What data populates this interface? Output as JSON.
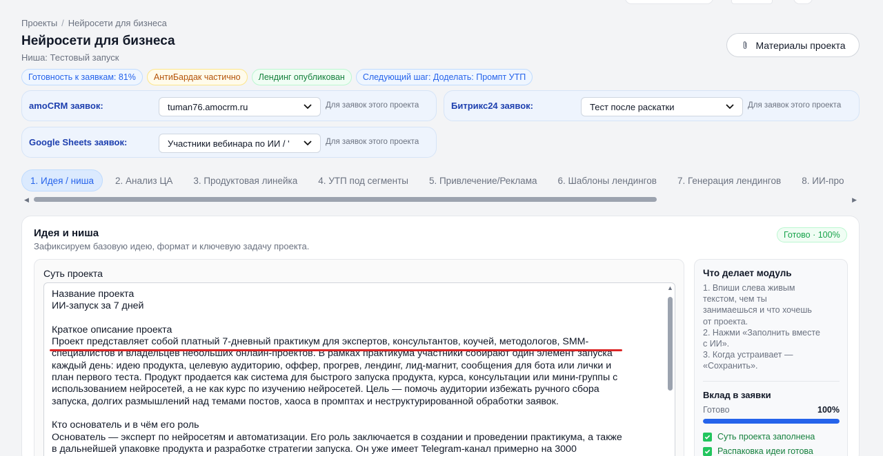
{
  "breadcrumb": {
    "root": "Проекты",
    "separator": "/",
    "current": "Нейросети для бизнеса"
  },
  "header": {
    "title": "Нейросети для бизнеса",
    "niche": "Ниша: Тестовый запуск",
    "materials_button": "Материалы проекта"
  },
  "badges": [
    {
      "label": "Готовность к заявкам: 81%",
      "tone": "blue"
    },
    {
      "label": "АнтиБардак частично",
      "tone": "amber"
    },
    {
      "label": "Лендинг опубликован",
      "tone": "green"
    },
    {
      "label": "Следующий шаг: Доделать: Промпт УТП",
      "tone": "blue"
    }
  ],
  "integrations": {
    "amocrm": {
      "label": "amoCRM заявок:",
      "value": "tuman76.amocrm.ru",
      "hint": "Для заявок этого проекта"
    },
    "bitrix": {
      "label": "Битрикс24 заявок:",
      "value": "Тест после раскатки",
      "hint": "Для заявок этого проекта"
    },
    "gsheets": {
      "label": "Google Sheets заявок:",
      "value": "Участники вебинара по ИИ / '",
      "hint": "Для заявок этого проекта"
    }
  },
  "tabs": [
    "1. Идея / ниша",
    "2. Анализ ЦА",
    "3. Продуктовая линейка",
    "4. УТП под сегменты",
    "5. Привлечение/Реклама",
    "6. Шаблоны лендингов",
    "7. Генерация лендингов",
    "8. ИИ-про"
  ],
  "active_tab": 0,
  "module": {
    "title": "Идея и ниша",
    "subtitle": "Зафиксируем базовую идею, формат и ключевую задачу проекта.",
    "status": "Готово · 100%",
    "essence_label": "Суть проекта",
    "essence_lines": [
      "Название проекта",
      "ИИ-запуск за 7 дней",
      "",
      "Краткое описание проекта",
      "Проект представляет собой платный 7-дневный практикум для экспертов, консультантов, коучей, методологов, SMM-",
      "специалистов и владельцев небольших онлайн-проектов. В рамках практикума участники собирают один элемент запуска",
      "каждый день: идею продукта, целевую аудиторию, оффер, прогрев, лендинг, лид-магнит, сообщения для бота или лички и",
      "план первого теста. Продукт продается как система для быстрого запуска продукта, курса, консультации или мини-группы с",
      "использованием нейросетей, а не как курс по изучению нейросетей. Цель — помочь аудитории избежать ручного сбора",
      "запуска, долгих размышлений над темами постов, хаоса в промптах и неструктурированной обработки заявок.",
      "",
      "Кто основатель и в чём его роль",
      "Основатель — эксперт по нейросетям и автоматизации. Его роль заключается в создании и проведении практикума, а также",
      "в дальнейшей упаковке продукта и разработке стратегии запуска. Он уже имеет Telegram-канал примерно на 3000"
    ]
  },
  "side": {
    "title": "Что делает модуль",
    "steps": [
      "1. Впиши слева живым",
      "текстом, чем ты",
      "занимаешься и что хочешь",
      "от проекта.",
      "2. Нажми «Заполнить вместе",
      "с ИИ».",
      "3. Когда устраивает —",
      "«Сохранить»."
    ],
    "contribution_title": "Вклад в заявки",
    "progress_label": "Готово",
    "progress_value": "100%",
    "progress_fraction": 1.0,
    "checks": [
      "Суть проекта заполнена",
      "Распаковка идеи готова"
    ]
  },
  "colors": {
    "accent": "#2563eb",
    "success": "#22c55e",
    "underline": "#dc2626"
  }
}
